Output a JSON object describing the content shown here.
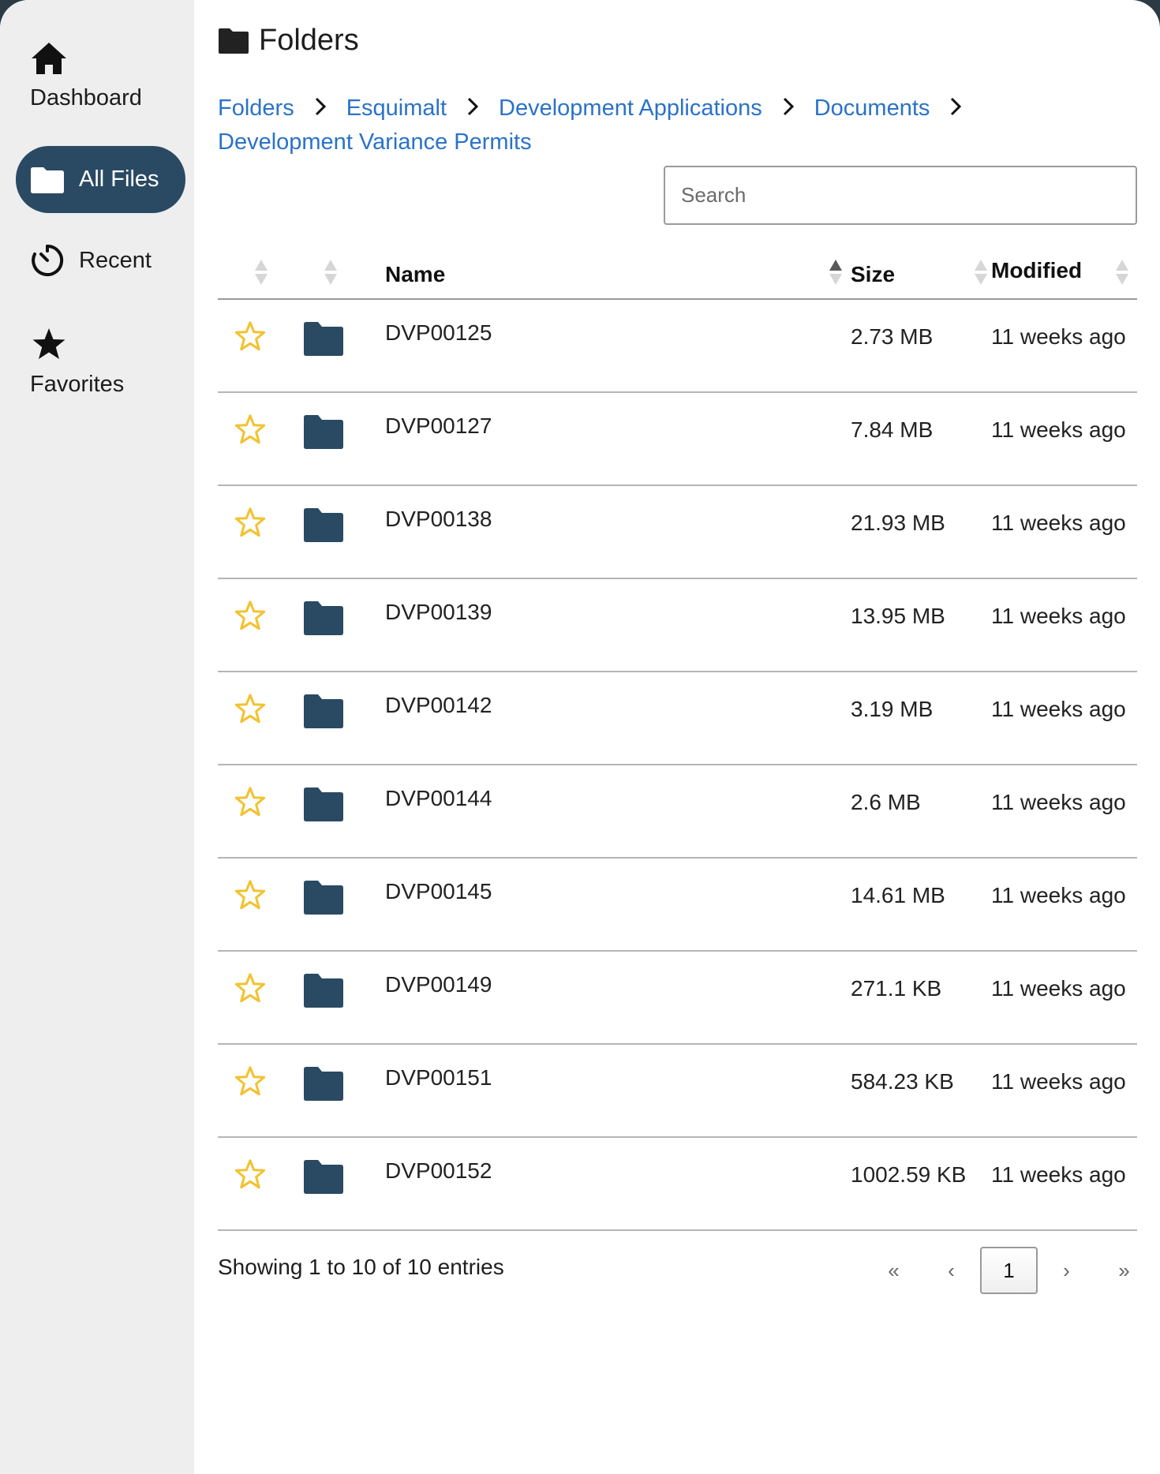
{
  "sidebar": {
    "items": [
      {
        "label": "Dashboard",
        "icon": "home-icon"
      },
      {
        "label": "All Files",
        "icon": "folder-icon"
      },
      {
        "label": "Recent",
        "icon": "clock-icon"
      },
      {
        "label": "Favorites",
        "icon": "star-icon"
      }
    ],
    "active_color": "#2a4a63"
  },
  "header": {
    "title": "Folders"
  },
  "breadcrumb": [
    "Folders",
    "Esquimalt",
    "Development Applications",
    "Documents",
    "Development Variance Permits"
  ],
  "search": {
    "placeholder": "Search",
    "value": ""
  },
  "table": {
    "columns": [
      "",
      "",
      "Name",
      "Size",
      "Modified"
    ],
    "sorted_column": "Name",
    "rows": [
      {
        "name": "DVP00125",
        "size": "2.73 MB",
        "modified": "11 weeks ago"
      },
      {
        "name": "DVP00127",
        "size": "7.84 MB",
        "modified": "11 weeks ago"
      },
      {
        "name": "DVP00138",
        "size": "21.93 MB",
        "modified": "11 weeks ago"
      },
      {
        "name": "DVP00139",
        "size": "13.95 MB",
        "modified": "11 weeks ago"
      },
      {
        "name": "DVP00142",
        "size": "3.19 MB",
        "modified": "11 weeks ago"
      },
      {
        "name": "DVP00144",
        "size": "2.6 MB",
        "modified": "11 weeks ago"
      },
      {
        "name": "DVP00145",
        "size": "14.61 MB",
        "modified": "11 weeks ago"
      },
      {
        "name": "DVP00149",
        "size": "271.1 KB",
        "modified": "11 weeks ago"
      },
      {
        "name": "DVP00151",
        "size": "584.23 KB",
        "modified": "11 weeks ago"
      },
      {
        "name": "DVP00152",
        "size": "1002.59 KB",
        "modified": "11 weeks ago"
      }
    ]
  },
  "footer": {
    "info": "Showing 1 to 10 of 10 entries",
    "pager": {
      "first": "«",
      "prev": "‹",
      "current": "1",
      "next": "›",
      "last": "»"
    }
  },
  "colors": {
    "link": "#2a72c9",
    "folder": "#2a4a63",
    "star": "#f2c230"
  }
}
